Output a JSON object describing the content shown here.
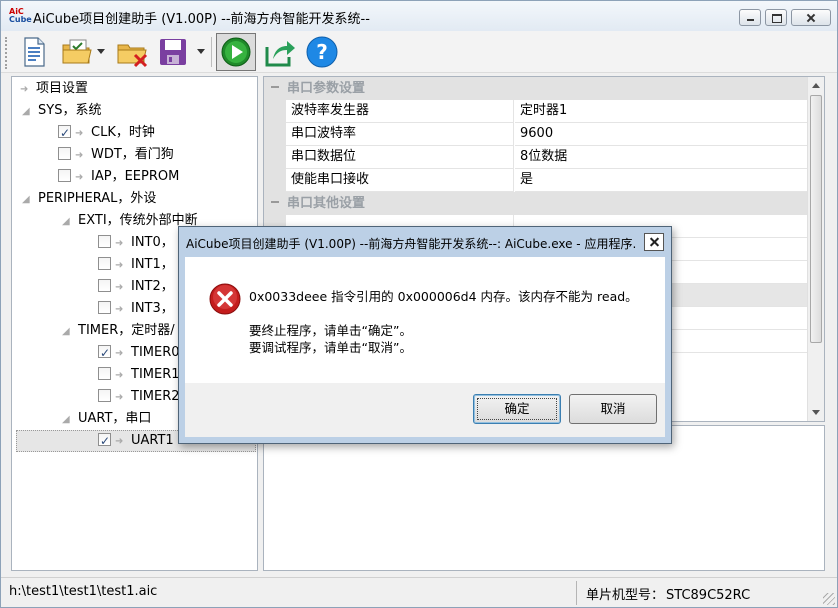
{
  "window": {
    "title": "AiCube项目创建助手 (V1.00P) --前海方舟智能开发系统--",
    "logo_top": "AiC",
    "logo_bottom": "Cube"
  },
  "toolbar": {
    "buttons": [
      {
        "icon": "new-document-icon"
      },
      {
        "icon": "open-folder-icon"
      },
      {
        "icon": "close-folder-icon"
      },
      {
        "icon": "save-disk-icon"
      },
      {
        "icon": "run-icon"
      },
      {
        "icon": "export-icon"
      },
      {
        "icon": "help-icon"
      }
    ]
  },
  "tree": {
    "items": [
      {
        "label": "项目设置"
      },
      {
        "label": "SYS，系统"
      },
      {
        "label": "CLK，时钟",
        "checked": true
      },
      {
        "label": "WDT，看门狗",
        "checked": false
      },
      {
        "label": "IAP，EEPROM",
        "checked": false
      },
      {
        "label": "PERIPHERAL，外设"
      },
      {
        "label": "EXTI，传统外部中断"
      },
      {
        "label": "INT0，",
        "checked": false
      },
      {
        "label": "INT1，",
        "checked": false
      },
      {
        "label": "INT2，",
        "checked": false
      },
      {
        "label": "INT3，",
        "checked": false
      },
      {
        "label": "TIMER，定时器/",
        "checked": false
      },
      {
        "label": "TIMER0",
        "checked": true
      },
      {
        "label": "TIMER1",
        "checked": false
      },
      {
        "label": "TIMER2",
        "checked": false
      },
      {
        "label": "UART，串口"
      },
      {
        "label": "UART1",
        "checked": true
      }
    ]
  },
  "props": {
    "category1": "串口参数设置",
    "rows": [
      {
        "name": "波特率发生器",
        "value": "定时器1"
      },
      {
        "name": "串口波特率",
        "value": "9600"
      },
      {
        "name": "串口数据位",
        "value": "8位数据"
      },
      {
        "name": "使能串口接收",
        "value": "是"
      }
    ],
    "category2": "串口其他设置"
  },
  "status": {
    "path": "h:\\test1\\test1\\test1.aic",
    "model_label": "单片机型号：",
    "model_value": "STC89C52RC"
  },
  "dialog": {
    "title": "AiCube项目创建助手 (V1.00P) --前海方舟智能开发系统--: AiCube.exe - 应用程序...",
    "message": "0x0033deee 指令引用的 0x000006d4 内存。该内存不能为 read。",
    "line1": "要终止程序，请单击“确定”。",
    "line2": "要调试程序，请单击“取消”。",
    "ok_label": "确定",
    "cancel_label": "取消",
    "icon": "error-icon"
  }
}
